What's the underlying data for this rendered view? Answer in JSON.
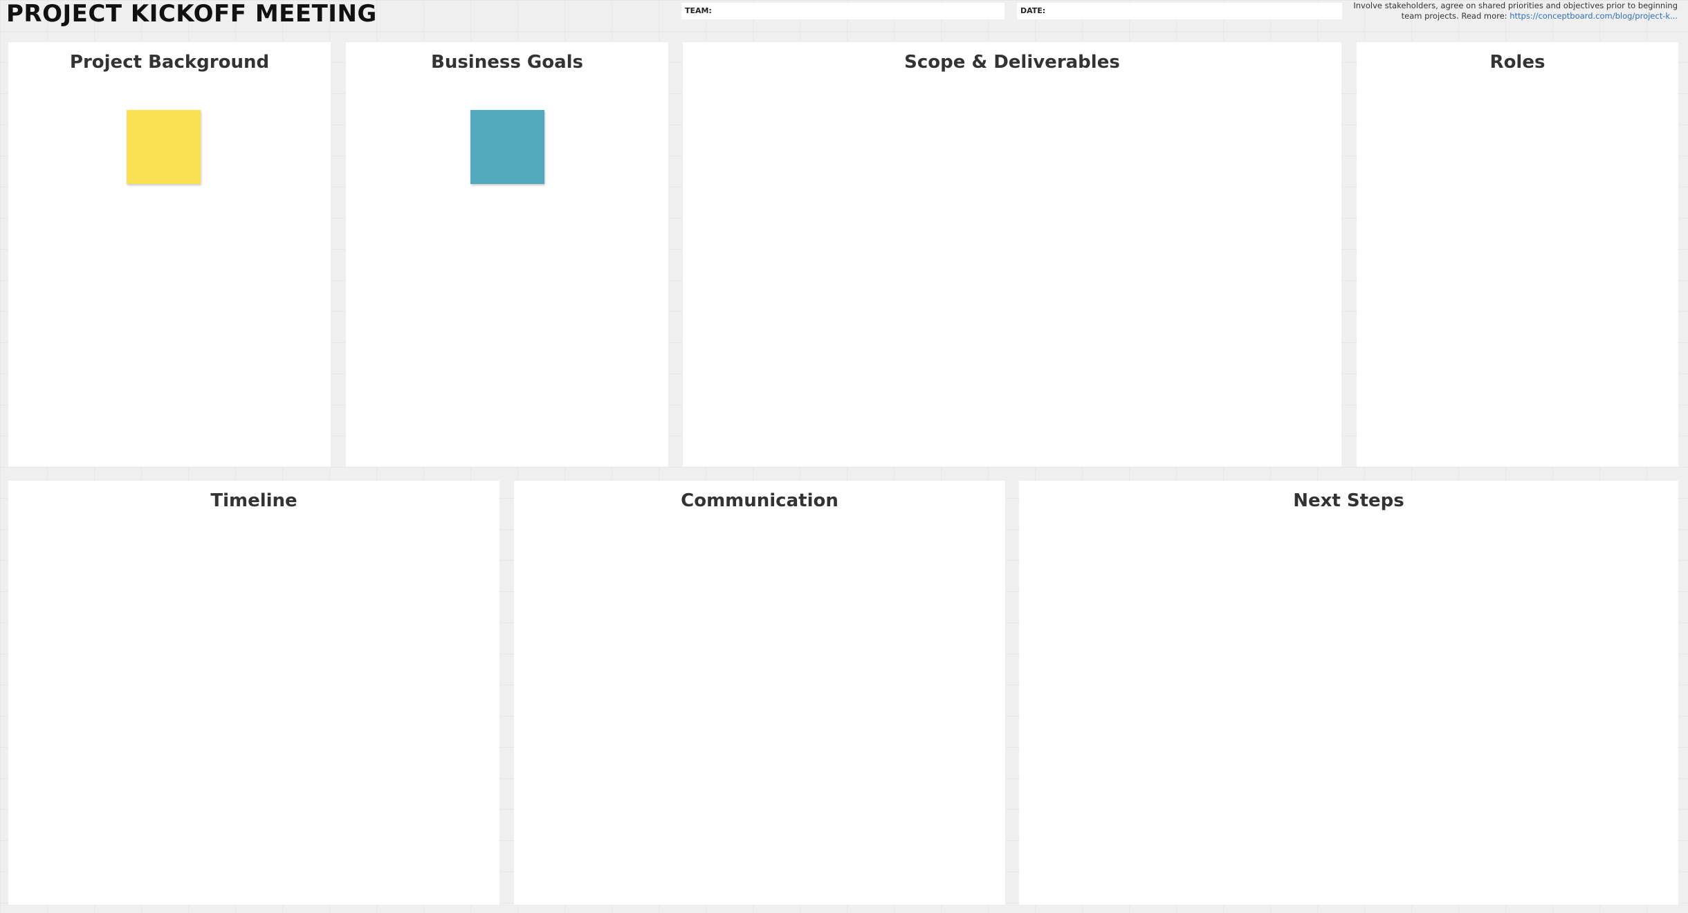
{
  "board": {
    "title": "PROJECT KICKOFF MEETING"
  },
  "fields": {
    "team_label": "TEAM:",
    "date_label": "DATE:"
  },
  "intro": {
    "text": "Involve stakeholders, agree on shared priorities and objectives prior to beginning team projects. Read more: ",
    "link": "https://conceptboard.com/blog/project-k..."
  },
  "panels": {
    "background": "Project Background",
    "goals": "Business Goals",
    "scope": "Scope & Deliverables",
    "roles": "Roles",
    "timeline": "Timeline",
    "communication": "Communication",
    "next_steps": "Next Steps"
  },
  "stickies": [
    {
      "color": "#f9df52"
    },
    {
      "color": "#52a9bd"
    }
  ]
}
